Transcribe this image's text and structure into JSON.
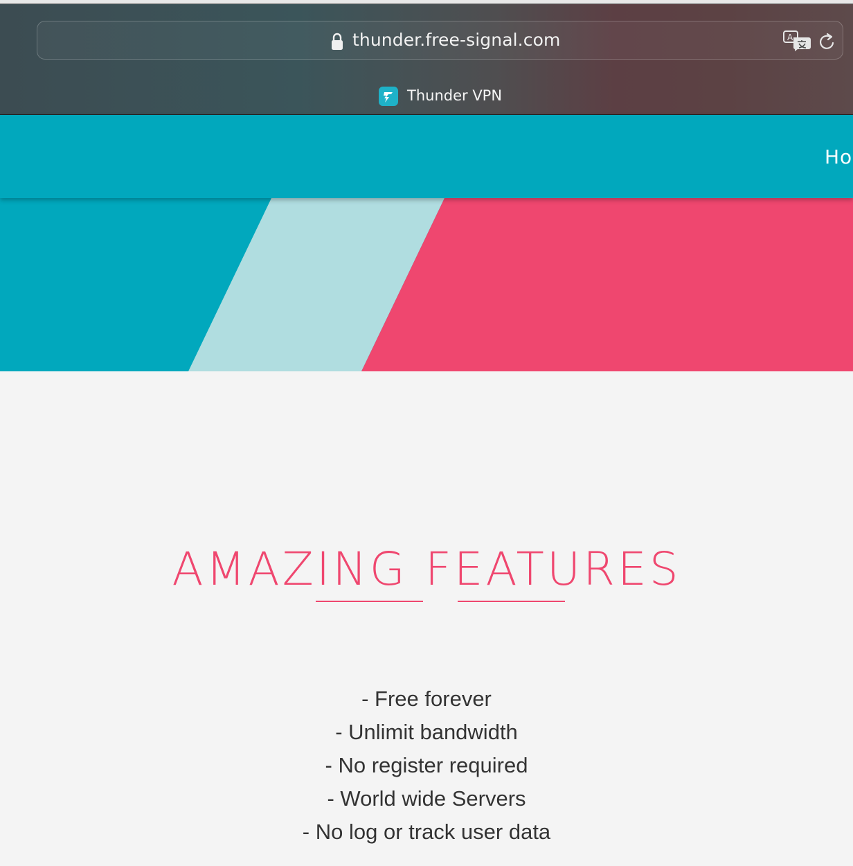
{
  "browser": {
    "url": "thunder.free-signal.com",
    "tab_title": "Thunder VPN",
    "icons": [
      "lock-icon",
      "translate-icon",
      "reload-icon",
      "thunder-favicon"
    ]
  },
  "nav": {
    "visible_label": "Ho"
  },
  "features": {
    "title": "AMAZING FEATURES",
    "items": [
      "- Free forever",
      "- Unlimit bandwidth",
      "- No register required",
      "- World wide Servers",
      "- No log or track user data"
    ]
  },
  "colors": {
    "teal": "#01a8bd",
    "light_teal": "#b0dde0",
    "pink": "#ef476f",
    "text": "#333333",
    "page_bg": "#f4f4f4"
  }
}
